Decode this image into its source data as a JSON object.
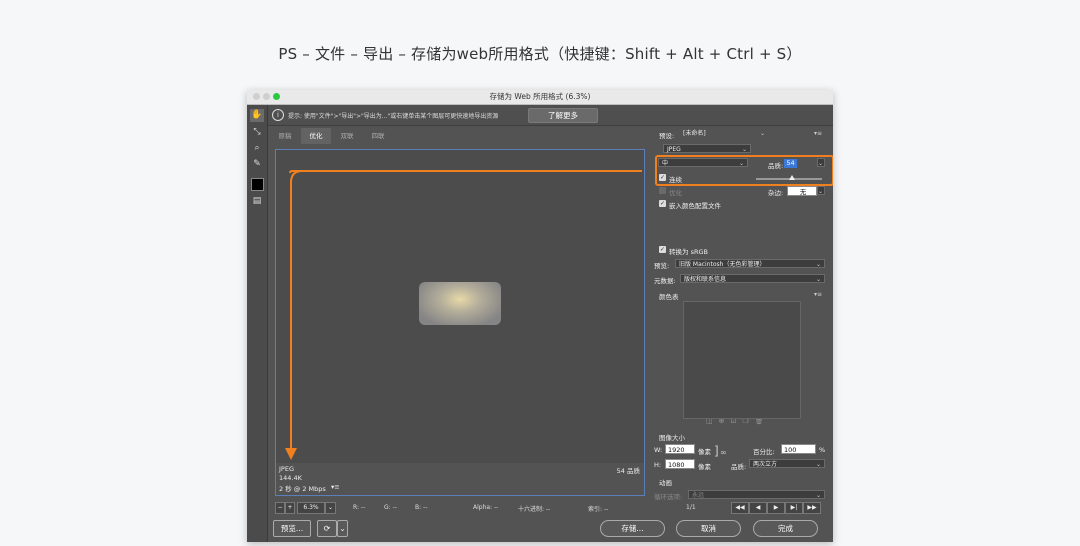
{
  "caption": "PS – 文件 – 导出 – 存储为web所用格式（快捷键：Shift + Alt + Ctrl + S）",
  "window": {
    "title": "存储为 Web 所用格式 (6.3%)"
  },
  "hint": {
    "text": "提示: 使用\"文件\">\"导出\">\"导出为...\"或右键单击某个图层可更快速地导出资源",
    "learn_more": "了解更多"
  },
  "tabs": [
    "原稿",
    "优化",
    "双联",
    "四联"
  ],
  "canvas_info": {
    "format": "JPEG",
    "size": "144.4K",
    "speed": "2 秒 @ 2 Mbps",
    "speed_menu": "▾≡",
    "quality": "54 品质"
  },
  "status": {
    "zoom": "6.3%",
    "r": "R: --",
    "g": "G: --",
    "b": "B: --",
    "alpha": "Alpha: --",
    "hex": "十六进制: --",
    "index": "索引: --"
  },
  "bottom": {
    "preview": "预览...",
    "save": "存储...",
    "cancel": "取消",
    "done": "完成",
    "page": "1/1"
  },
  "settings": {
    "preset_label": "预设:",
    "preset_value": "[未命名]",
    "format_value": "JPEG",
    "quality_level": "中",
    "quality_label": "品质:",
    "quality_value": "54",
    "progressive_label": "连续",
    "optimize_label": "优化",
    "blur_label": "杂边:",
    "blur_value": "无",
    "embed_profile_label": "嵌入颜色配置文件",
    "convert_srgb_label": "转换为 sRGB",
    "preview_label": "预览:",
    "preview_value": "旧版 Macintosh（无色彩管理）",
    "metadata_label": "元数据:",
    "metadata_value": "版权和联系信息",
    "color_table_label": "颜色表",
    "image_size_label": "图像大小",
    "w_label": "W:",
    "w_value": "1920",
    "h_label": "H:",
    "h_value": "1080",
    "px_unit": "像素",
    "percent_label": "百分比:",
    "percent_value": "100",
    "percent_unit": "%",
    "resample_label": "品质:",
    "resample_value": "两次立方",
    "animation_label": "动画",
    "loop_label": "循环选项:",
    "loop_value": "永远"
  },
  "colors": {
    "accent_orange": "#f0801f",
    "selection_blue": "#3b78d8",
    "canvas_border": "#5b7fb8"
  }
}
